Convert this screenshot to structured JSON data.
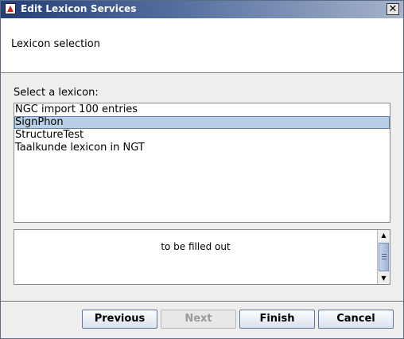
{
  "window": {
    "title": "Edit Lexicon Services",
    "close_glyph": "✕"
  },
  "header": {
    "title": "Lexicon selection"
  },
  "main": {
    "select_label": "Select a lexicon:",
    "lexicons": [
      {
        "label": "NGC import 100 entries",
        "selected": false
      },
      {
        "label": "SignPhon",
        "selected": true
      },
      {
        "label": "StructureTest",
        "selected": false
      },
      {
        "label": "Taalkunde lexicon in NGT",
        "selected": false
      }
    ],
    "description": "to be filled out",
    "scroll_up_glyph": "▲",
    "scroll_down_glyph": "▼"
  },
  "footer": {
    "previous_label": "Previous",
    "next_label": "Next",
    "finish_label": "Finish",
    "cancel_label": "Cancel",
    "next_enabled": false
  },
  "colors": {
    "selection": "#b8cfe5",
    "titlebar_start": "#243f78",
    "titlebar_end": "#a6b3cb"
  }
}
